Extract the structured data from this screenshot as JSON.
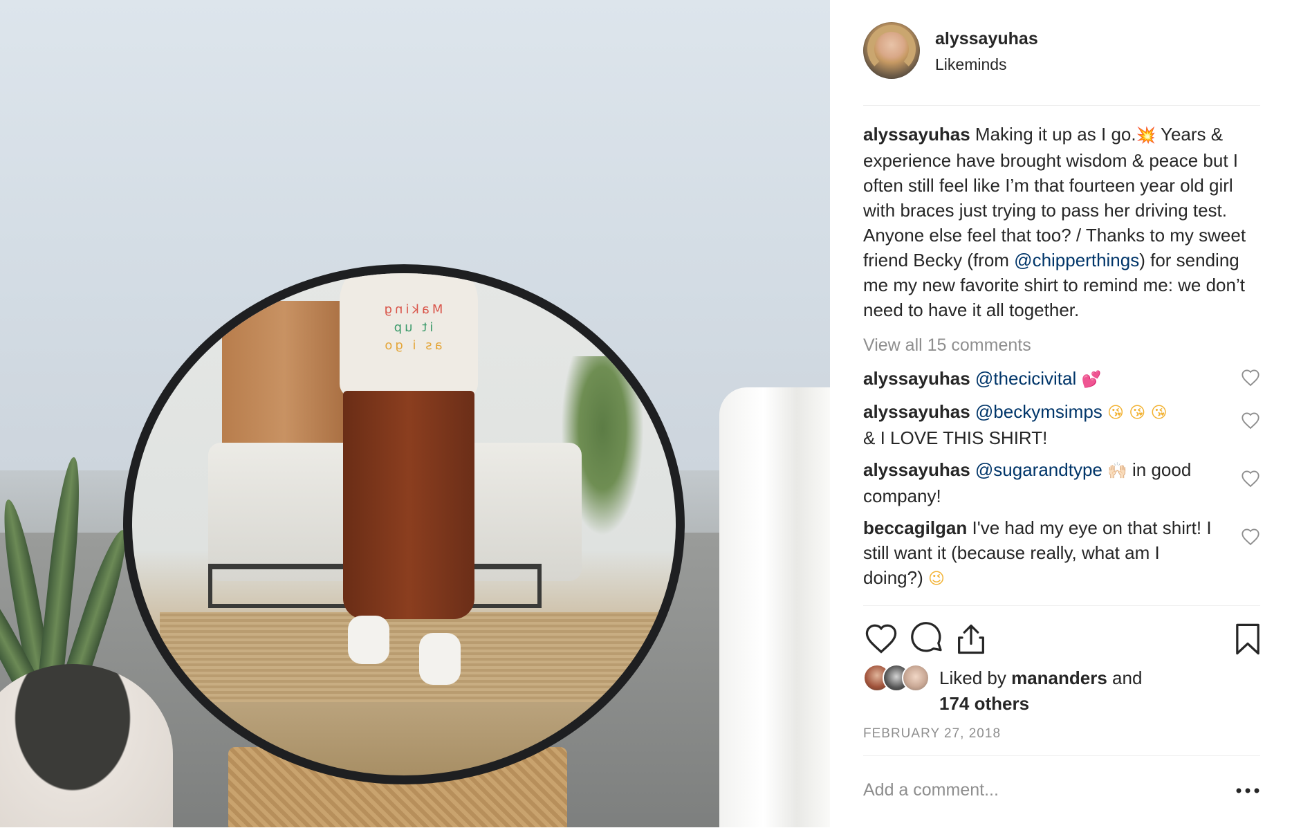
{
  "post": {
    "username": "alyssayuhas",
    "location": "Likeminds",
    "caption_text_1": "Making it up as I go.",
    "caption_emoji": "💥",
    "caption_text_2": "  Years & experience have brought wisdom & peace but I often still feel like I’m that fourteen year old girl with braces just trying to pass her driving test. Anyone else feel that too? / Thanks to my sweet friend Becky (from ",
    "caption_mention": "@chipperthings",
    "caption_text_3": ") for sending me my new favorite shirt to remind me: we don’t need to have it all together.",
    "shirt_text": [
      "Making",
      "it up",
      "as i go"
    ],
    "view_all": "View all 15 comments",
    "comments": [
      {
        "user": "alyssayuhas",
        "mention": "@thecicivital",
        "emoji": "💕",
        "text": ""
      },
      {
        "user": "alyssayuhas",
        "mention": "@beckymsimps",
        "emoji": "😘 😘 😘",
        "text": "& I LOVE THIS SHIRT!"
      },
      {
        "user": "alyssayuhas",
        "mention": "@sugarandtype",
        "emoji": "🙌🏻",
        "text": "in good company!"
      },
      {
        "user": "beccagilgan",
        "mention": "",
        "emoji": "😉",
        "text": "I've had my eye on that shirt! I still want it (because really, what am I doing?)"
      }
    ],
    "likes_prefix": "Liked by ",
    "likes_user": "mananders",
    "likes_and": " and",
    "likes_others": "174 others",
    "date": "FEBRUARY 27, 2018",
    "comment_placeholder": "Add a comment...",
    "icons": {
      "like": "heart-icon",
      "comment": "comment-bubble-icon",
      "share": "share-icon",
      "save": "bookmark-icon",
      "more": "more-options-icon"
    },
    "colors": {
      "mention": "#003569",
      "muted": "#8e8e8e",
      "text": "#262626"
    }
  }
}
